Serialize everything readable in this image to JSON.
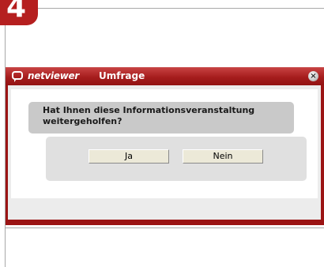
{
  "step": {
    "number": "4"
  },
  "window": {
    "brand": "netviewer",
    "title": "Umfrage",
    "close_glyph": "×"
  },
  "survey": {
    "question": "Hat Ihnen diese Informationsveranstaltung weitergeholfen?",
    "answers": {
      "yes": "Ja",
      "no": "Nein"
    }
  },
  "colors": {
    "titlebar": "#a51c1c",
    "badge": "#b51f1f",
    "question_bg": "#c9c9c9",
    "answer_bg": "#e0e0e0"
  },
  "icons": {
    "logo": "speech-bubble-icon",
    "close": "close-icon"
  }
}
